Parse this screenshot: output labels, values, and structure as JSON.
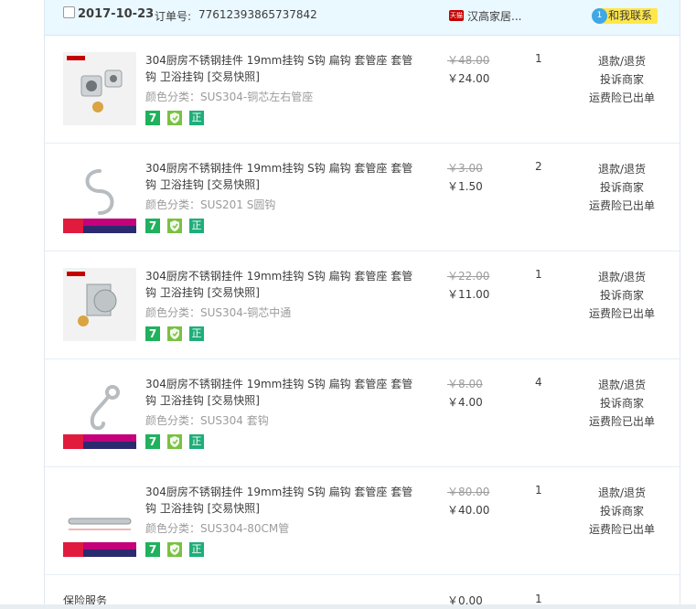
{
  "order": {
    "date": "2017-10-23",
    "order_no_label": "订单号:",
    "order_no": "77612393865737842",
    "shop_badge": "天猫",
    "shop_name": "汉高家居...",
    "contact_label": "和我联系",
    "contact_badge": "1"
  },
  "items": [
    {
      "title": "304厨房不锈钢挂件 19mm挂钩 S钩 扁钩 套管座 套管钩 卫浴挂钩 [交易快照]",
      "variant": "颜色分类：SUS304-铜芯左右管座",
      "orig_price": "￥48.00",
      "price": "￥24.00",
      "qty": "1",
      "refund": "退款/退货",
      "complain": "投诉商家",
      "shipping_ins": "运费险已出单",
      "img": "pipe-seat"
    },
    {
      "title": "304厨房不锈钢挂件 19mm挂钩 S钩 扁钩 套管座 套管钩 卫浴挂钩 [交易快照]",
      "variant": "颜色分类：SUS201 S圆钩",
      "orig_price": "￥3.00",
      "price": "￥1.50",
      "qty": "2",
      "refund": "退款/退货",
      "complain": "投诉商家",
      "shipping_ins": "运费险已出单",
      "img": "s-hook"
    },
    {
      "title": "304厨房不锈钢挂件 19mm挂钩 S钩 扁钩 套管座 套管钩 卫浴挂钩 [交易快照]",
      "variant": "颜色分类：SUS304-铜芯中通",
      "orig_price": "￥22.00",
      "price": "￥11.00",
      "qty": "1",
      "refund": "退款/退货",
      "complain": "投诉商家",
      "shipping_ins": "运费险已出单",
      "img": "mid-seat"
    },
    {
      "title": "304厨房不锈钢挂件 19mm挂钩 S钩 扁钩 套管座 套管钩 卫浴挂钩 [交易快照]",
      "variant": "颜色分类：SUS304 套钩",
      "orig_price": "￥8.00",
      "price": "￥4.00",
      "qty": "4",
      "refund": "退款/退货",
      "complain": "投诉商家",
      "shipping_ins": "运费险已出单",
      "img": "sleeve-hook"
    },
    {
      "title": "304厨房不锈钢挂件 19mm挂钩 S钩 扁钩 套管座 套管钩 卫浴挂钩 [交易快照]",
      "variant": "颜色分类：SUS304-80CM管",
      "orig_price": "￥80.00",
      "price": "￥40.00",
      "qty": "1",
      "refund": "退款/退货",
      "complain": "投诉商家",
      "shipping_ins": "运费险已出单",
      "img": "tube"
    }
  ],
  "badges": {
    "seven": "7",
    "zheng": "正"
  },
  "insurance": {
    "label": "保险服务",
    "price": "￥0.00",
    "qty": "1"
  },
  "colors": {
    "header_bg": "#eaf8ff",
    "contact_bg": "#ffe74a",
    "badge_green": "#20b15d"
  }
}
